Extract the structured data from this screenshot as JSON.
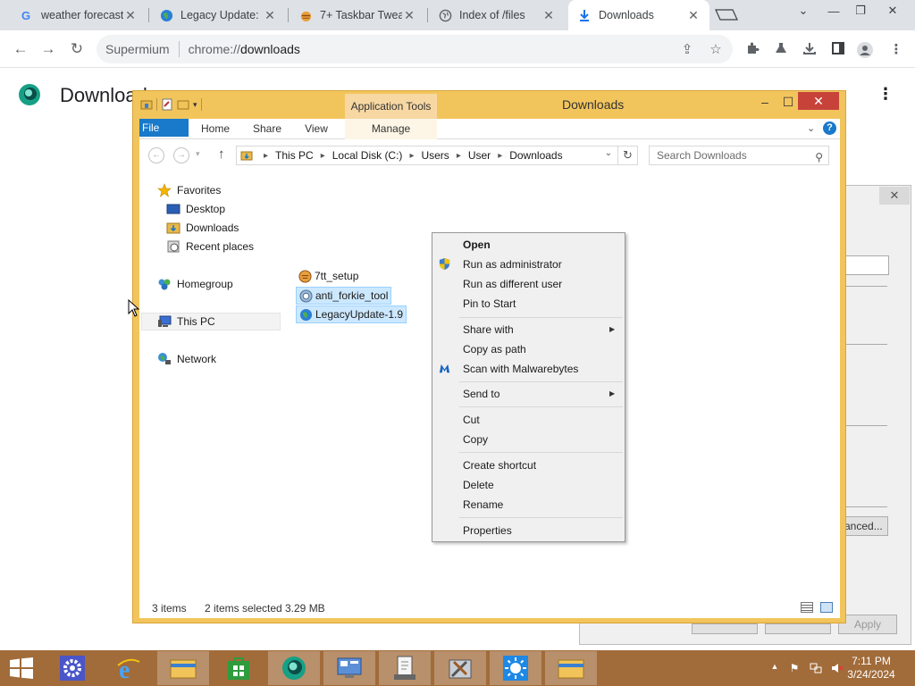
{
  "browser": {
    "tabs": [
      {
        "title": "weather forecast",
        "icon": "google-icon"
      },
      {
        "title": "Legacy Update: ",
        "icon": "globe-icon"
      },
      {
        "title": "7+ Taskbar Twea",
        "icon": "pie-icon"
      },
      {
        "title": "Index of /files",
        "icon": "globe-icon"
      },
      {
        "title": "Downloads",
        "icon": "download-icon"
      }
    ],
    "omnibox": {
      "site_label": "Supermium",
      "url_scheme": "chrome://",
      "url_path": "downloads"
    },
    "page_title": "Downloads"
  },
  "explorer": {
    "title": "Downloads",
    "contextual_tab": "Application Tools",
    "ribbon_tabs": [
      "File",
      "Home",
      "Share",
      "View",
      "Manage"
    ],
    "breadcrumb": [
      "This PC",
      "Local Disk (C:)",
      "Users",
      "User",
      "Downloads"
    ],
    "search_placeholder": "Search Downloads",
    "nav": {
      "favorites": "Favorites",
      "desktop": "Desktop",
      "downloads": "Downloads",
      "recent": "Recent places",
      "homegroup": "Homegroup",
      "thispc": "This PC",
      "network": "Network"
    },
    "files": [
      {
        "name": "7tt_setup",
        "selected": false
      },
      {
        "name": "anti_forkie_tool",
        "selected": true
      },
      {
        "name": "LegacyUpdate-1.9",
        "selected": true
      }
    ],
    "status": {
      "items": "3 items",
      "selected": "2 items selected",
      "size": "3.29 MB"
    }
  },
  "context_menu": {
    "open": "Open",
    "run_admin": "Run as administrator",
    "run_other": "Run as different user",
    "pin_start": "Pin to Start",
    "share_with": "Share with",
    "copy_path": "Copy as path",
    "scan": "Scan with Malwarebytes",
    "send_to": "Send to",
    "cut": "Cut",
    "copy": "Copy",
    "create_shortcut": "Create shortcut",
    "delete": "Delete",
    "rename": "Rename",
    "properties": "Properties"
  },
  "background_dialog": {
    "advanced_button": "anced...",
    "apply_button": "Apply"
  },
  "taskbar": {
    "time": "7:11 PM",
    "date": "3/24/2024"
  },
  "colors": {
    "taskbar": "#a16b3a",
    "explorer_frame": "#f2c55c",
    "file_tab": "#1979ca",
    "selection": "#cce8ff",
    "close_button": "#c7433a"
  }
}
